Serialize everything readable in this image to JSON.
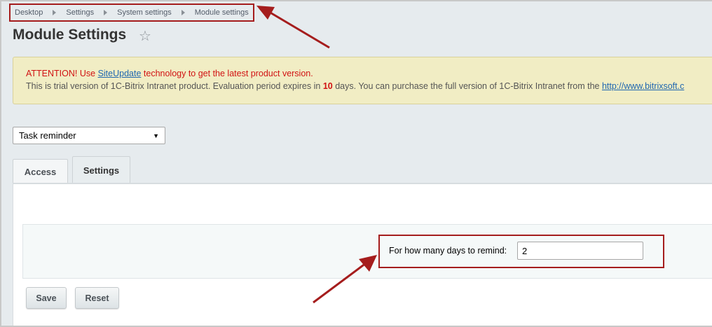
{
  "breadcrumb": {
    "items": [
      "Desktop",
      "Settings",
      "System settings",
      "Module settings"
    ]
  },
  "page": {
    "title": "Module Settings",
    "favorite_icon": "star-outline-icon"
  },
  "notice": {
    "attention_prefix": "ATTENTION! Use ",
    "siteupdate_link": "SiteUpdate",
    "attention_suffix": " technology to get the latest product version.",
    "trial_prefix": "This is trial version of 1C-Bitrix Intranet product. Evaluation period expires in ",
    "trial_days": "10",
    "trial_suffix": " days. You can purchase the full version of 1C-Bitrix Intranet from the ",
    "purchase_link": "http://www.bitrixsoft.c"
  },
  "module_select": {
    "selected": "Task reminder"
  },
  "tabs": [
    {
      "label": "Access",
      "active": false
    },
    {
      "label": "Settings",
      "active": true
    }
  ],
  "settings": {
    "days_label": "For how many days to remind:",
    "days_value": "2"
  },
  "buttons": {
    "save": "Save",
    "reset": "Reset"
  },
  "colors": {
    "annotation": "#a51d1d",
    "attention_text": "#d11313",
    "link": "#2067b0",
    "notice_bg": "#f1edc4"
  }
}
